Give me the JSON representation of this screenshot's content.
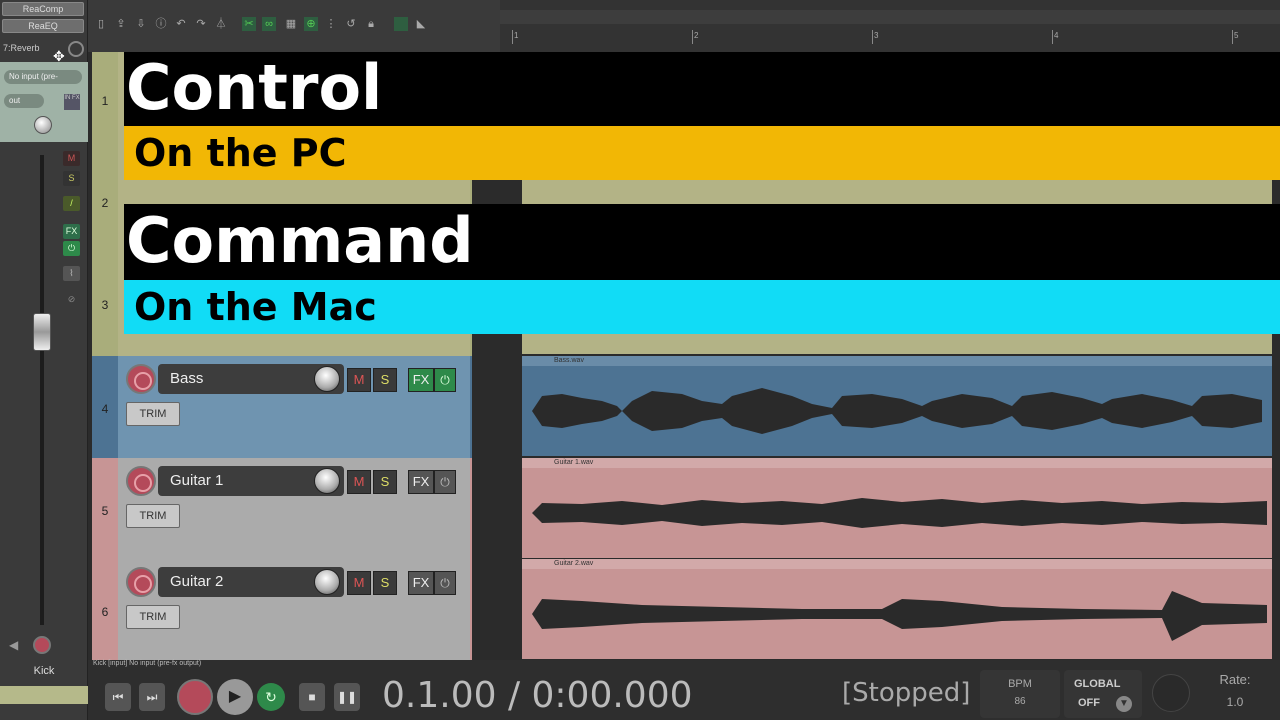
{
  "mixer": {
    "fx_slots": [
      "ReaComp",
      "ReaEQ"
    ],
    "reverb_label": "7:Reverb",
    "input_label": "No input (pre-",
    "out_label": "out",
    "track_name": "Kick",
    "io_label": "IN FX",
    "btn_m": "M",
    "btn_s": "S",
    "btn_fx": "FX"
  },
  "ruler": {
    "ticks": [
      "1",
      "2",
      "3",
      "4",
      "5"
    ]
  },
  "tracks": [
    {
      "num": "1"
    },
    {
      "num": "2"
    },
    {
      "num": "3"
    },
    {
      "num": "4",
      "name": "Bass",
      "trim": "TRIM",
      "mute": "M",
      "solo": "S",
      "fx": "FX",
      "file": "Bass.wav"
    },
    {
      "num": "5",
      "name": "Guitar 1",
      "trim": "TRIM",
      "mute": "M",
      "solo": "S",
      "fx": "FX",
      "file": "Guitar 1.wav"
    },
    {
      "num": "6",
      "name": "Guitar 2",
      "trim": "TRIM",
      "mute": "M",
      "solo": "S",
      "fx": "FX",
      "file": "Guitar 2.wav"
    }
  ],
  "overlay": {
    "title1": "Control",
    "sub1": "On the PC",
    "title2": "Command",
    "sub2": "On the Mac"
  },
  "colors": {
    "sub1_bg": "#f2b705",
    "sub2_bg": "#11dcf6",
    "bass_lane": "#4d7393",
    "guitar_lane": "#c79595",
    "olive_lane": "#a9ad7b"
  },
  "transport": {
    "status": "Kick [input] No input (pre-fx output)",
    "time": "0.1.00 / 0:00.000",
    "state": "[Stopped]",
    "bpm_label": "BPM",
    "bpm_value": "86",
    "global_label": "GLOBAL",
    "global_value": "OFF",
    "rate_label": "Rate:",
    "rate_value": "1.0"
  }
}
